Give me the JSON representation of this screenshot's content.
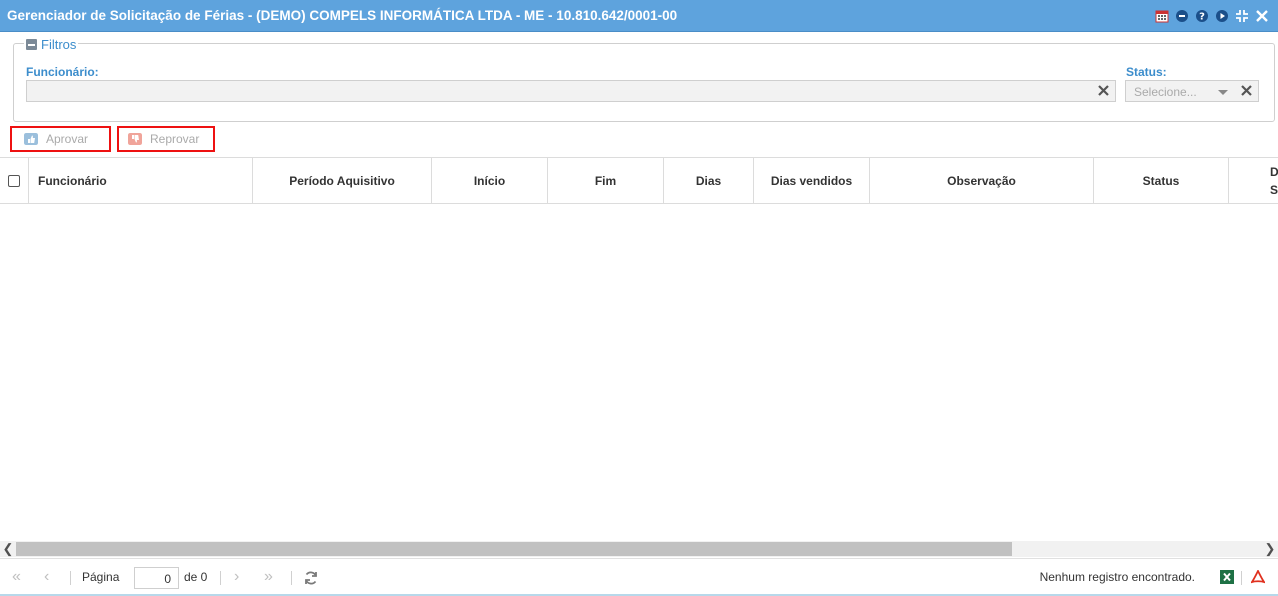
{
  "window": {
    "title": "Gerenciador de Solicitação de Férias - (DEMO) COMPELS INFORMÁTICA LTDA - ME - 10.810.642/0001-00",
    "tools": [
      "calendar-icon",
      "minimize-icon",
      "help-icon",
      "play-icon",
      "collapse-icon",
      "close-icon"
    ]
  },
  "filters": {
    "legend": "Filtros",
    "employee_label": "Funcionário:",
    "employee_value": "",
    "status_label": "Status:",
    "status_placeholder": "Selecione..."
  },
  "actions": {
    "approve_label": "Aprovar",
    "reject_label": "Reprovar"
  },
  "grid": {
    "columns": [
      "Funcionário",
      "Período Aquisitivo",
      "Início",
      "Fim",
      "Dias",
      "Dias vendidos",
      "Observação",
      "Status",
      "D S"
    ],
    "rows": []
  },
  "pager": {
    "page_label": "Página",
    "page_value": "0",
    "of_label": "de 0",
    "status_message": "Nenhum registro encontrado."
  },
  "colors": {
    "titlebar": "#5ea3dd",
    "label_blue": "#3c8dcc",
    "highlight_red": "#e11111"
  }
}
